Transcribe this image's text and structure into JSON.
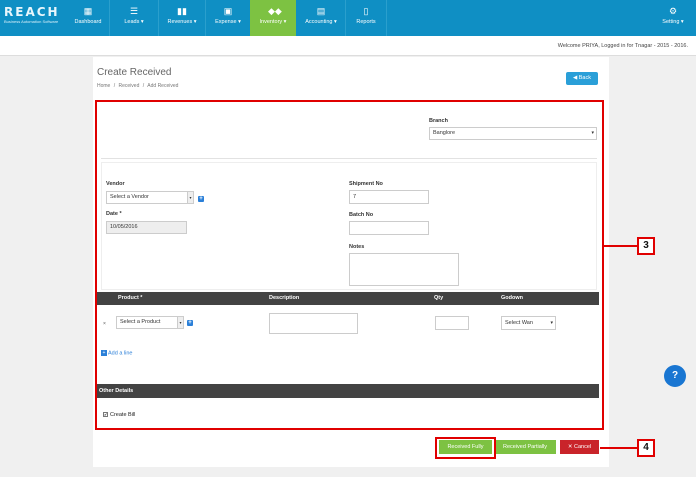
{
  "logo": {
    "word": "REACH",
    "tagline": "Business Automation Software"
  },
  "nav": {
    "items": [
      {
        "label": "Dashboard",
        "icon": "dashboard-icon"
      },
      {
        "label": "Leads ▾",
        "icon": "list-icon"
      },
      {
        "label": "Revenues ▾",
        "icon": "bar-chart-icon"
      },
      {
        "label": "Expense ▾",
        "icon": "money-icon"
      },
      {
        "label": "Inventory ▾",
        "icon": "cubes-icon"
      },
      {
        "label": "Accounting ▾",
        "icon": "calculator-icon"
      },
      {
        "label": "Reports",
        "icon": "document-icon"
      }
    ],
    "settings_label": "Setting ▾",
    "active_color": "#7dc242",
    "bar_color": "#0f8fc4"
  },
  "welcome": "Welcome PRIYA, Logged in for Tnagar - 2015 - 2016.",
  "page": {
    "title": "Create Received",
    "breadcrumb": [
      "Home",
      "/",
      "Received",
      "/",
      "Add Received"
    ],
    "back_label": "◀ Back"
  },
  "form": {
    "branch_label": "Branch",
    "branch_value": "Banglore",
    "vendor_label": "Vendor",
    "vendor_placeholder": "Select a Vendor",
    "date_label": "Date *",
    "date_value": "10/05/2016",
    "shipment_label": "Shipment No",
    "shipment_value": "7",
    "batch_label": "Batch No",
    "batch_value": "",
    "notes_label": "Notes",
    "notes_value": ""
  },
  "items_table": {
    "headers": [
      "Product *",
      "Description",
      "Qty",
      "Godown"
    ],
    "row": {
      "remove": "×",
      "product_placeholder": "Select a Product",
      "description": "",
      "qty": "",
      "godown": "Select Wan"
    },
    "add_line_label": "Add a line"
  },
  "other_details": {
    "title": "Other Details",
    "create_bill_label": "Create Bill",
    "create_bill_checked": true
  },
  "actions": {
    "received_fully": "Received Fully",
    "received_partially": "Received Partially",
    "cancel": "✕ Cancel"
  },
  "annotations": {
    "callout_3": "3",
    "callout_4": "4",
    "color": "#e00000"
  },
  "help_icon": "?"
}
